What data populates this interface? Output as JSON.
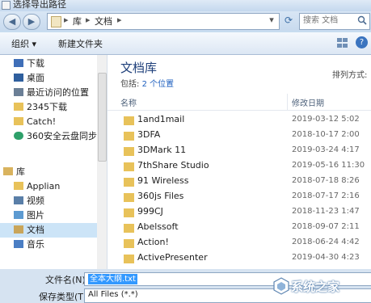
{
  "window": {
    "title": "选择导出路径"
  },
  "address": {
    "crumbs": [
      "库",
      "文档"
    ],
    "search_placeholder": "搜索 文档"
  },
  "toolbar": {
    "organize": "组织 ▾",
    "new_folder": "新建文件夹"
  },
  "nav": {
    "items": [
      {
        "label": "下载",
        "icon": "download-folder-icon",
        "color": "#3f6fb8"
      },
      {
        "label": "桌面",
        "icon": "desktop-icon",
        "color": "#2f5f9e"
      },
      {
        "label": "最近访问的位置",
        "icon": "recent-places-icon",
        "color": "#6b7f96"
      },
      {
        "label": "2345下载",
        "icon": "folder-icon",
        "color": "#e8c25a"
      },
      {
        "label": "Catch!",
        "icon": "folder-icon",
        "color": "#e8c25a"
      },
      {
        "label": "360安全云盘同步",
        "icon": "cloud-sync-icon",
        "color": "#2ea06a"
      }
    ],
    "library_group": {
      "label": "库",
      "icon": "library-icon"
    },
    "library_items": [
      {
        "label": "Applian",
        "icon": "library-folder-icon",
        "color": "#e8c25a"
      },
      {
        "label": "视频",
        "icon": "video-library-icon",
        "color": "#5a7fa8"
      },
      {
        "label": "图片",
        "icon": "pictures-library-icon",
        "color": "#5c9ad1"
      },
      {
        "label": "文档",
        "icon": "documents-library-icon",
        "color": "#c9a55a"
      },
      {
        "label": "音乐",
        "icon": "music-library-icon",
        "color": "#4a7ec4"
      }
    ]
  },
  "content": {
    "library_title": "文档库",
    "includes_label": "包括:",
    "includes_link": "2 个位置",
    "sort_label": "排列方式:",
    "columns": {
      "name": "名称",
      "date": "修改日期"
    },
    "files": [
      {
        "name": "1and1mail",
        "date": "2019-03-12  5:02"
      },
      {
        "name": "3DFA",
        "date": "2018-10-17  2:00"
      },
      {
        "name": "3DMark 11",
        "date": "2019-03-24  4:17"
      },
      {
        "name": "7thShare Studio",
        "date": "2019-05-16  11:30"
      },
      {
        "name": "91 Wireless",
        "date": "2018-07-18  8:26"
      },
      {
        "name": "360js Files",
        "date": "2018-07-17  2:16"
      },
      {
        "name": "999CJ",
        "date": "2018-11-23  1:47"
      },
      {
        "name": "Abelssoft",
        "date": "2018-09-07  2:11"
      },
      {
        "name": "Action!",
        "date": "2018-06-24  4:42"
      },
      {
        "name": "ActivePresenter",
        "date": "2019-04-30  4:23"
      }
    ]
  },
  "footer": {
    "filename_label": "文件名(N):",
    "filename_value": "全本大纲.txt",
    "filetype_label": "保存类型(T):",
    "filetype_value": "All Files (*.*)"
  },
  "watermark": {
    "text": "系统之家"
  },
  "colors": {
    "folder": "#e8c25a",
    "accent": "#1d5fbf",
    "selection": "#3399ff"
  }
}
